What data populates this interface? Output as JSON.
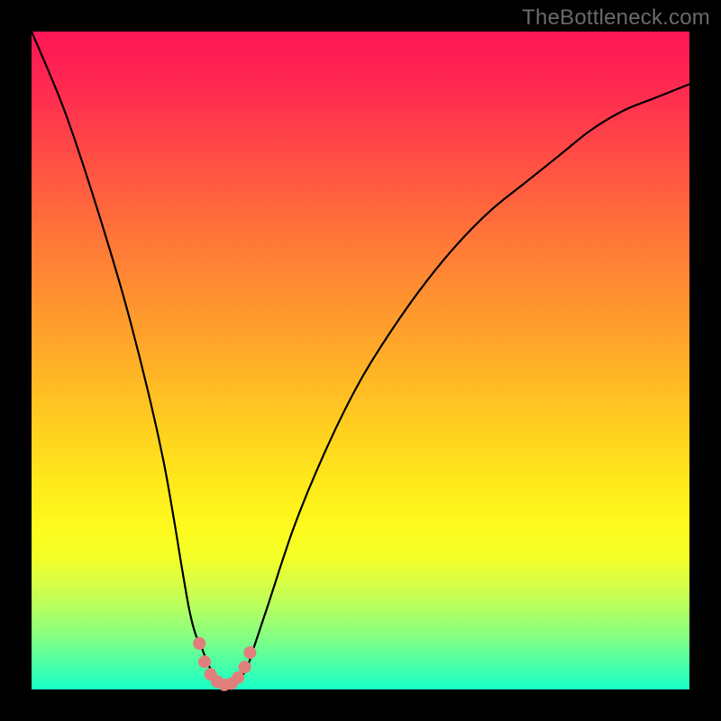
{
  "watermark": "TheBottleneck.com",
  "colors": {
    "background_frame": "#000000",
    "marker": "#e07f7b",
    "curve_stroke": "#000000",
    "gradient_top": "#ff1556",
    "gradient_bottom": "#17ffc9"
  },
  "chart_data": {
    "type": "line",
    "title": "",
    "xlabel": "",
    "ylabel": "",
    "xlim": [
      0,
      100
    ],
    "ylim": [
      0,
      100
    ],
    "grid": false,
    "x": [
      0,
      5,
      10,
      15,
      20,
      24,
      26,
      27,
      28,
      29,
      30,
      31,
      32,
      33,
      34,
      36,
      40,
      45,
      50,
      55,
      60,
      65,
      70,
      75,
      80,
      85,
      90,
      95,
      100
    ],
    "y": [
      100,
      88,
      73,
      56,
      35,
      12,
      6,
      3.5,
      2,
      1,
      0.5,
      1,
      2,
      4,
      7,
      13,
      25,
      37,
      47,
      55,
      62,
      68,
      73,
      77,
      81,
      85,
      88,
      90,
      92
    ],
    "annotations": [],
    "markers": {
      "note": "cluster of pink markers near the curve minimum",
      "points": [
        {
          "x": 25.5,
          "y": 7
        },
        {
          "x": 26.3,
          "y": 4.2
        },
        {
          "x": 27.2,
          "y": 2.3
        },
        {
          "x": 28.2,
          "y": 1.2
        },
        {
          "x": 29.3,
          "y": 0.7
        },
        {
          "x": 30.4,
          "y": 0.9
        },
        {
          "x": 31.4,
          "y": 1.8
        },
        {
          "x": 32.4,
          "y": 3.4
        },
        {
          "x": 33.2,
          "y": 5.6
        }
      ]
    }
  }
}
